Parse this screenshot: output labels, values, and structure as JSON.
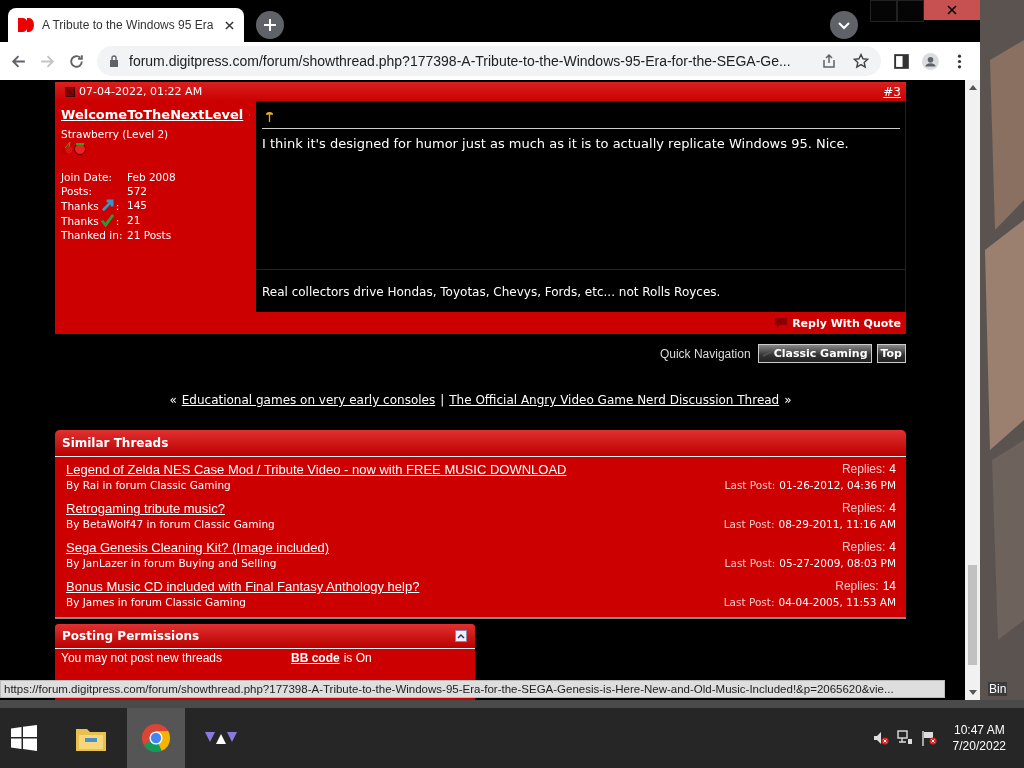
{
  "browser": {
    "tab": {
      "title": "A Tribute to the Windows 95 Era",
      "selected": true
    },
    "url": "forum.digitpress.com/forum/showthread.php?177398-A-Tribute-to-the-Windows-95-Era-for-the-SEGA-Ge...",
    "forward_disabled": true
  },
  "post": {
    "date": "07-04-2022, 01:22 AM",
    "number": "#3",
    "user": "WelcomeToTheNextLevel",
    "rank": "Strawberry (Level 2)",
    "stats": [
      {
        "kind": "plain",
        "label": "Join Date:",
        "value": "Feb 2008"
      },
      {
        "kind": "plain",
        "label": "Posts:",
        "value": "572"
      },
      {
        "kind": "thanks-given",
        "label": "Thanks",
        "suffix": ":",
        "value": "145"
      },
      {
        "kind": "thanks-received",
        "label": "Thanks",
        "suffix": ":",
        "value": "21"
      },
      {
        "kind": "plain",
        "label": "Thanked in:",
        "value": "21 Posts"
      }
    ],
    "message": "I think it's designed for humor just as much as it is to actually replicate Windows 95. Nice.",
    "signature": "Real collectors drive Hondas, Toyotas, Chevys, Fords, etc... not Rolls Royces.",
    "reply_button": "Reply With Quote"
  },
  "quick_nav": {
    "label": "Quick Navigation",
    "forum_button": "Classic Gaming",
    "top_button": "Top"
  },
  "thread_nav": {
    "open": "«",
    "prev": "Educational games on very early consoles",
    "separator": "|",
    "next": "The Official Angry Video Game Nerd Discussion Thread",
    "close": "»"
  },
  "similar_threads": {
    "title": "Similar Threads",
    "threads": [
      {
        "title": "Legend of Zelda NES Case Mod / Tribute Video - now with FREE MUSIC DOWNLOAD",
        "by": "By Rai in forum Classic Gaming",
        "replies_label": "Replies:",
        "replies": "4",
        "last_post_label": "Last Post:",
        "last_post": "01-26-2012, 04:36 PM"
      },
      {
        "title": "Retrogaming tribute music?",
        "by": "By BetaWolf47 in forum Classic Gaming",
        "replies_label": "Replies:",
        "replies": "4",
        "last_post_label": "Last Post:",
        "last_post": "08-29-2011, 11:16 AM"
      },
      {
        "title": "Sega Genesis Cleaning Kit? (Image included)",
        "by": "By JanLazer in forum Buying and Selling",
        "replies_label": "Replies:",
        "replies": "4",
        "last_post_label": "Last Post:",
        "last_post": "05-27-2009, 08:03 PM"
      },
      {
        "title": "Bonus Music CD included with Final Fantasy Anthology help?",
        "by": "By James in forum Classic Gaming",
        "replies_label": "Replies:",
        "replies": "14",
        "last_post_label": "Last Post:",
        "last_post": "04-04-2005, 11:53 AM"
      }
    ]
  },
  "posting_permissions": {
    "title": "Posting Permissions",
    "rows": [
      {
        "text": "You may not post new threads",
        "setting": "BB code",
        "state": "is On"
      }
    ]
  },
  "status_url": "https://forum.digitpress.com/forum/showthread.php?177398-A-Tribute-to-the-Windows-95-Era-for-the-SEGA-Genesis-is-Here-New-and-Old-Music-Included!&p=2065620&vie...",
  "desktop_label": "Bin",
  "taskbar": {
    "apps": [
      {
        "kind": "explorer",
        "selected": false
      },
      {
        "kind": "chrome",
        "selected": true
      },
      {
        "kind": "app",
        "selected": false
      }
    ],
    "time": "10:47 AM",
    "date": "7/20/2022"
  }
}
